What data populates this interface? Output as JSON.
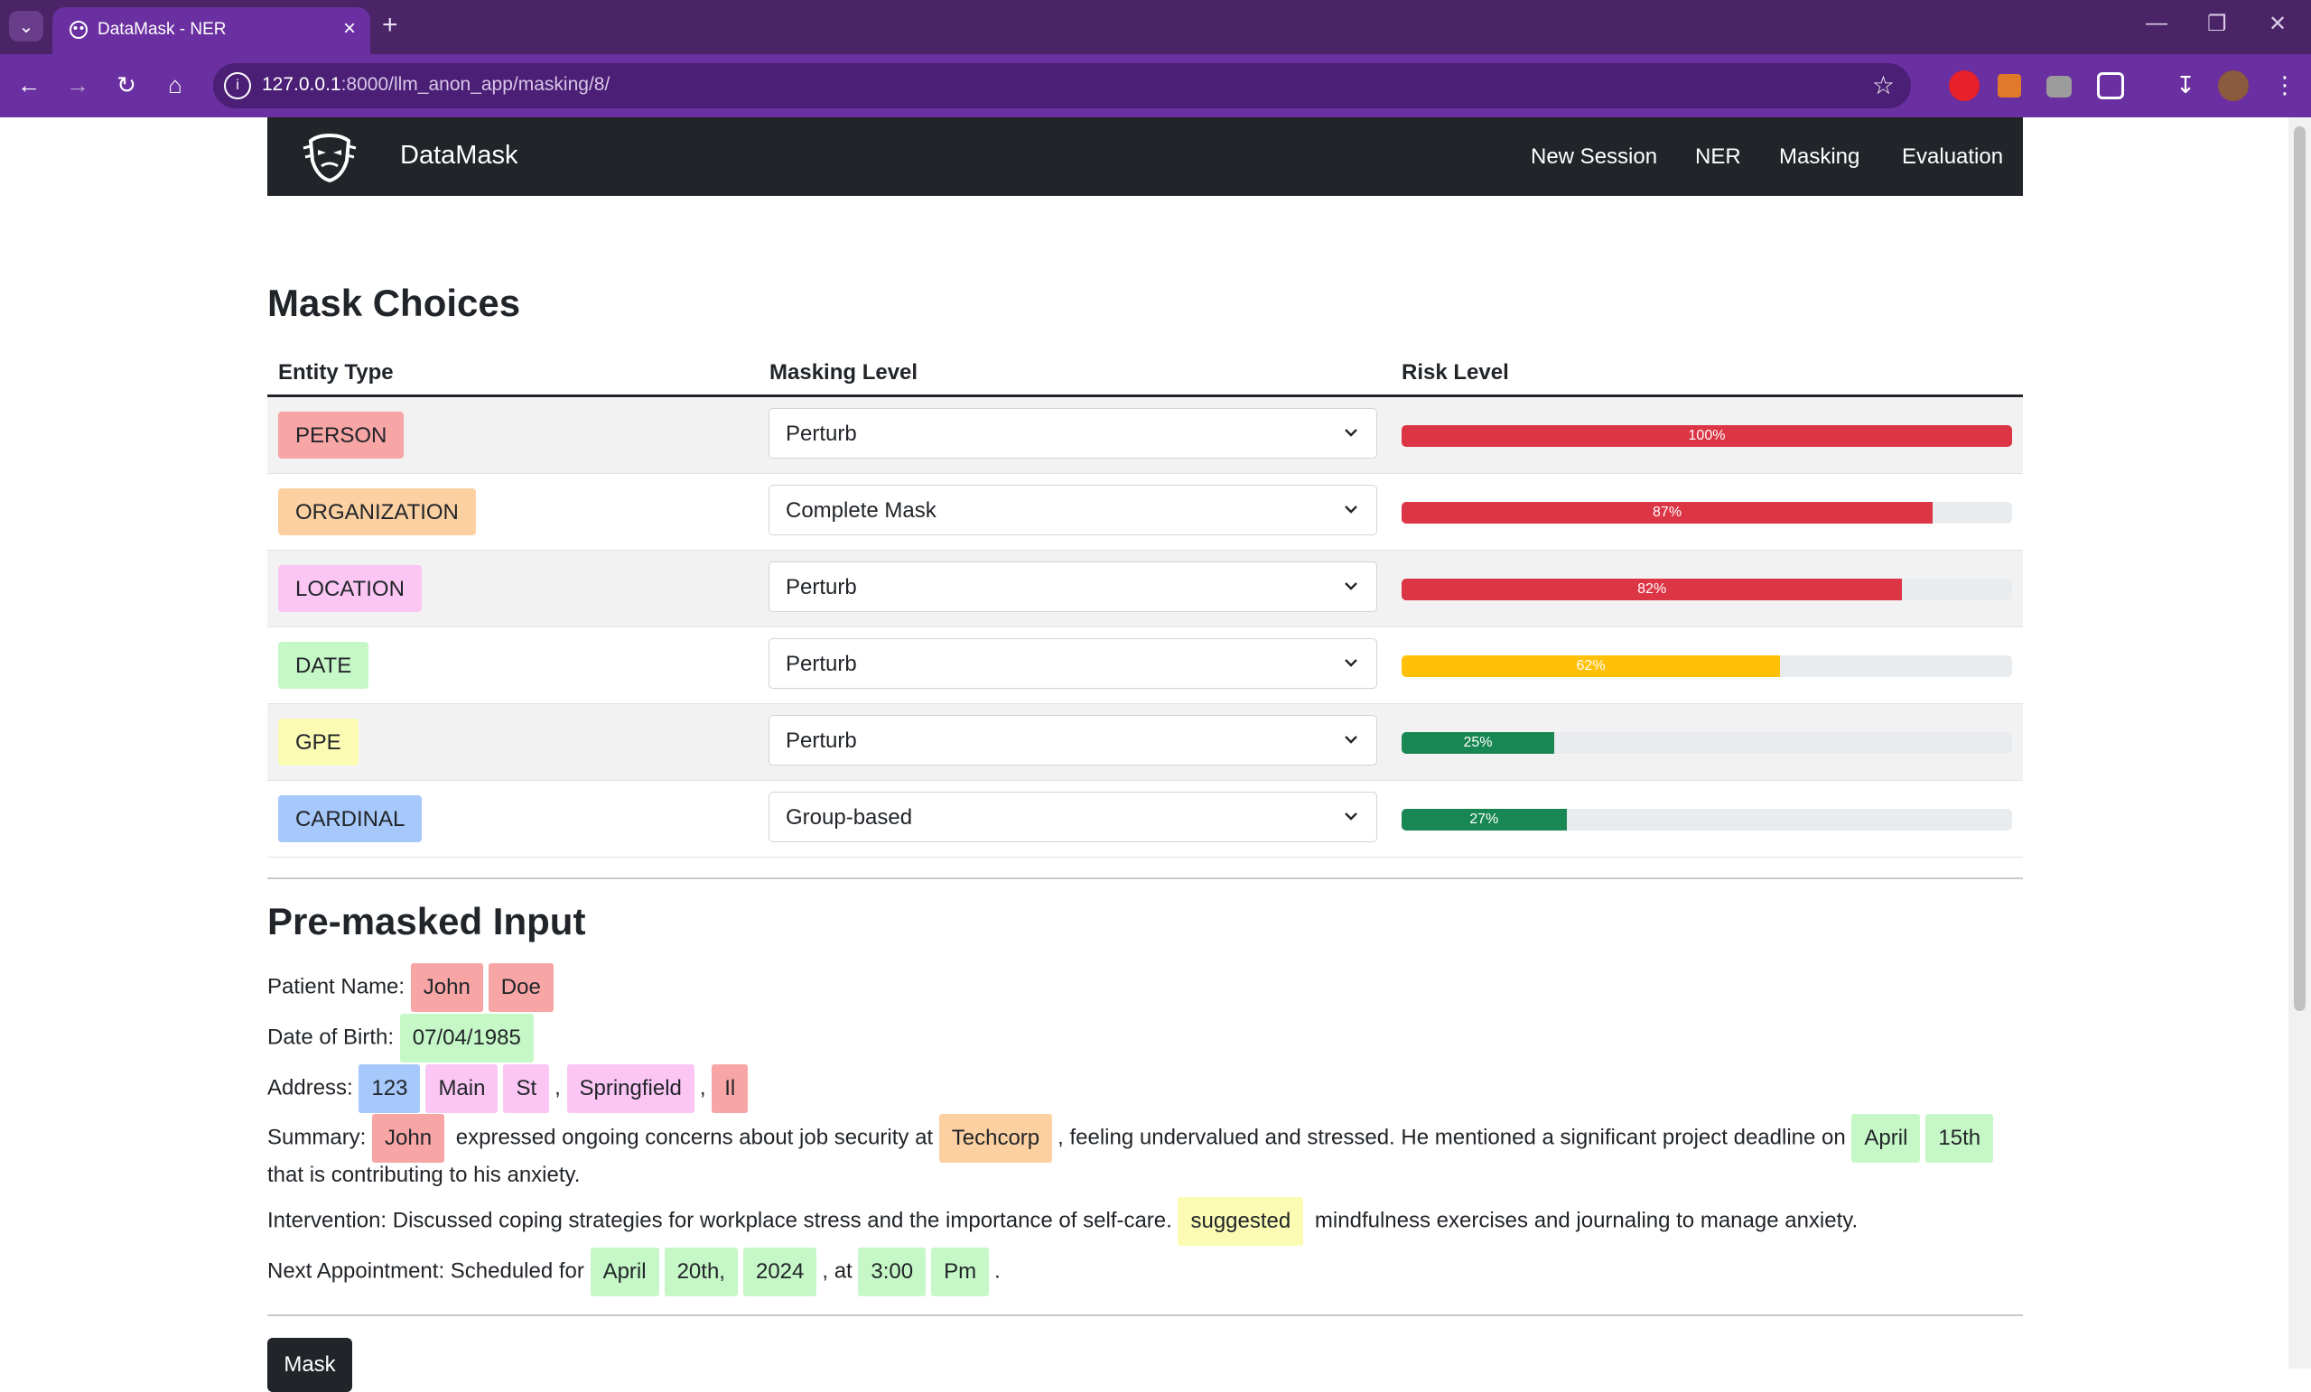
{
  "browser": {
    "tab_title": "DataMask - NER",
    "url_host": "127.0.0.1",
    "url_path": ":8000/llm_anon_app/masking/8/"
  },
  "navbar": {
    "brand": "DataMask",
    "links": [
      "New Session",
      "NER",
      "Masking",
      "Evaluation"
    ]
  },
  "mask_choices": {
    "title": "Mask Choices",
    "headers": [
      "Entity Type",
      "Masking Level",
      "Risk Level"
    ],
    "rows": [
      {
        "entity": "PERSON",
        "level": "Perturb",
        "risk": "100%",
        "risk_value": 1.0,
        "entity_color": "#f8a5a5",
        "risk_color": "#dc3545"
      },
      {
        "entity": "ORGANIZATION",
        "level": "Complete Mask",
        "risk": "87%",
        "risk_value": 0.87,
        "entity_color": "#fdd0a2",
        "risk_color": "#dc3545"
      },
      {
        "entity": "LOCATION",
        "level": "Perturb",
        "risk": "82%",
        "risk_value": 0.82,
        "entity_color": "#fbc6f4",
        "risk_color": "#dc3545"
      },
      {
        "entity": "DATE",
        "level": "Perturb",
        "risk": "62%",
        "risk_value": 0.62,
        "entity_color": "#c6f7c6",
        "risk_color": "#ffc107"
      },
      {
        "entity": "GPE",
        "level": "Perturb",
        "risk": "25%",
        "risk_value": 0.25,
        "entity_color": "#fbfbb4",
        "risk_color": "#198754"
      },
      {
        "entity": "CARDINAL",
        "level": "Group-based",
        "risk": "27%",
        "risk_value": 0.27,
        "entity_color": "#a6c8fb",
        "risk_color": "#198754"
      }
    ]
  },
  "pre_masked": {
    "title": "Pre-masked Input",
    "patient_label": "Patient Name:",
    "patient_first": "John",
    "patient_last": "Doe",
    "dob_label": "Date of Birth:",
    "dob": "07/04/1985",
    "address_label": "Address:",
    "addr_num": "123",
    "addr_street": "Main",
    "addr_st": "St",
    "addr_city": "Springfield",
    "addr_state": "Il",
    "comma": ",",
    "summary_label": "Summary:",
    "summary_name": "John",
    "summary_text1": "expressed ongoing concerns about job security at",
    "summary_org": "Techcorp",
    "summary_text2": ", feeling undervalued and stressed. He mentioned a significant project deadline on",
    "summary_month": "April",
    "summary_day": "15th",
    "summary_text3": "that is contributing to his anxiety.",
    "intervention_text1": "Intervention: Discussed coping strategies for workplace stress and the importance of self-care.",
    "intervention_gpe": "suggested",
    "intervention_text2": "mindfulness exercises and journaling to manage anxiety.",
    "appt_label": "Next Appointment: Scheduled for",
    "appt_month": "April",
    "appt_day": "20th,",
    "appt_year": "2024",
    "appt_at": ", at",
    "appt_time": "3:00",
    "appt_ampm": "Pm",
    "appt_end": "."
  },
  "mask_button": "Mask"
}
